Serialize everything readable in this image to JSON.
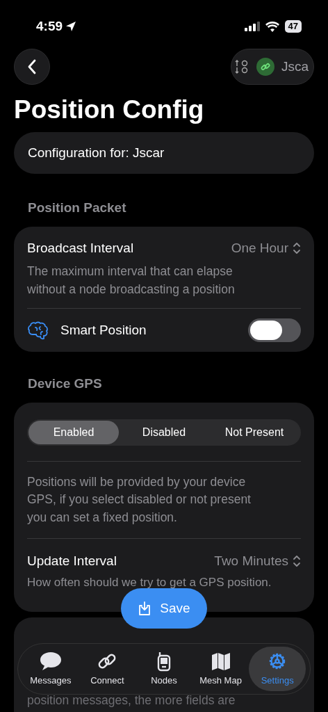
{
  "status_bar": {
    "time": "4:59",
    "battery": "47"
  },
  "nav": {
    "device_name": "Jsca"
  },
  "title": "Position Config",
  "config_for": "Configuration for: Jscar",
  "position_packet": {
    "header": "Position Packet",
    "broadcast_interval": {
      "label": "Broadcast Interval",
      "value": "One Hour",
      "description": "The maximum interval that can elapse without a node broadcasting a position"
    },
    "smart_position": {
      "label": "Smart Position",
      "on": false
    }
  },
  "device_gps": {
    "header": "Device GPS",
    "segments": [
      {
        "label": "Enabled",
        "selected": true
      },
      {
        "label": "Disabled",
        "selected": false
      },
      {
        "label": "Not Present",
        "selected": false
      }
    ],
    "description": "Positions will be provided by your device GPS, if you select disabled or not present you can set a fixed position.",
    "update_interval": {
      "label": "Update Interval",
      "value": "Two Minutes",
      "description": "How often should we try to get a GPS position."
    }
  },
  "save_button": "Save",
  "tab_bar": [
    {
      "kind": "messages",
      "label": "Messages",
      "selected": false
    },
    {
      "kind": "connect",
      "label": "Connect",
      "selected": false
    },
    {
      "kind": "nodes",
      "label": "Nodes",
      "selected": false
    },
    {
      "kind": "map",
      "label": "Mesh Map",
      "selected": false
    },
    {
      "kind": "settings",
      "label": "Settings",
      "selected": true
    }
  ],
  "next_section_text": "position messages, the more fields are"
}
